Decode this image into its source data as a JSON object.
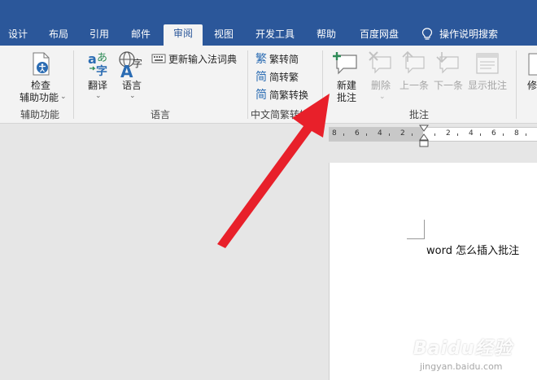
{
  "tabs": [
    {
      "label": "设计",
      "active": false
    },
    {
      "label": "布局",
      "active": false
    },
    {
      "label": "引用",
      "active": false
    },
    {
      "label": "邮件",
      "active": false
    },
    {
      "label": "审阅",
      "active": true
    },
    {
      "label": "视图",
      "active": false
    },
    {
      "label": "开发工具",
      "active": false
    },
    {
      "label": "帮助",
      "active": false
    },
    {
      "label": "百度网盘",
      "active": false
    }
  ],
  "tell_me": "操作说明搜索",
  "ribbon": {
    "accessibility": {
      "check_line1": "检查",
      "check_line2": "辅助功能",
      "group_label": "辅助功能"
    },
    "language": {
      "translate": "翻译",
      "language": "语言",
      "update_ime": "更新输入法词典",
      "group_label": "语言"
    },
    "chinese": {
      "t2s": "繁转简",
      "s2t": "简转繁",
      "convert": "简繁转换",
      "group_label": "中文简繁转换"
    },
    "comments": {
      "new_line1": "新建",
      "new_line2": "批注",
      "delete": "删除",
      "previous": "上一条",
      "next": "下一条",
      "show": "显示批注",
      "group_label": "批注"
    },
    "track_partial": "修"
  },
  "ruler": {
    "left_numbers": [
      "8",
      "6",
      "4",
      "2"
    ],
    "right_numbers": [
      "2",
      "4",
      "6",
      "8",
      "10",
      "12",
      "14"
    ]
  },
  "document": {
    "text": "word 怎么插入批注"
  },
  "watermark": {
    "main": "Baidu经验",
    "sub": "jingyan.baidu.com"
  },
  "colors": {
    "tab_bar": "#2b579a",
    "ribbon": "#f3f3f3",
    "arrow": "#e8202a"
  }
}
